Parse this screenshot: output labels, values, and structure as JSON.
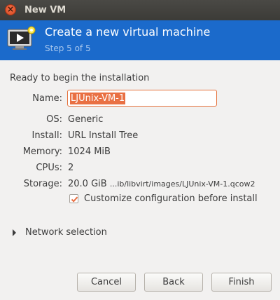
{
  "window": {
    "title": "New VM"
  },
  "banner": {
    "title": "Create a new virtual machine",
    "step": "Step 5 of 5"
  },
  "summary": {
    "heading": "Ready to begin the installation",
    "name_label": "Name:",
    "name_value": "LJUnix-VM-1",
    "os_label": "OS:",
    "os_value": "Generic",
    "install_label": "Install:",
    "install_value": "URL Install Tree",
    "memory_label": "Memory:",
    "memory_value": "1024 MiB",
    "cpus_label": "CPUs:",
    "cpus_value": "2",
    "storage_label": "Storage:",
    "storage_size": "20.0 GiB",
    "storage_path": "...ib/libvirt/images/LJUnix-VM-1.qcow2"
  },
  "customize": {
    "label": "Customize configuration before install",
    "checked": true
  },
  "network": {
    "label": "Network selection"
  },
  "buttons": {
    "cancel": "Cancel",
    "back": "Back",
    "finish": "Finish"
  },
  "colors": {
    "banner": "#1b6acb",
    "accent": "#e97043"
  }
}
